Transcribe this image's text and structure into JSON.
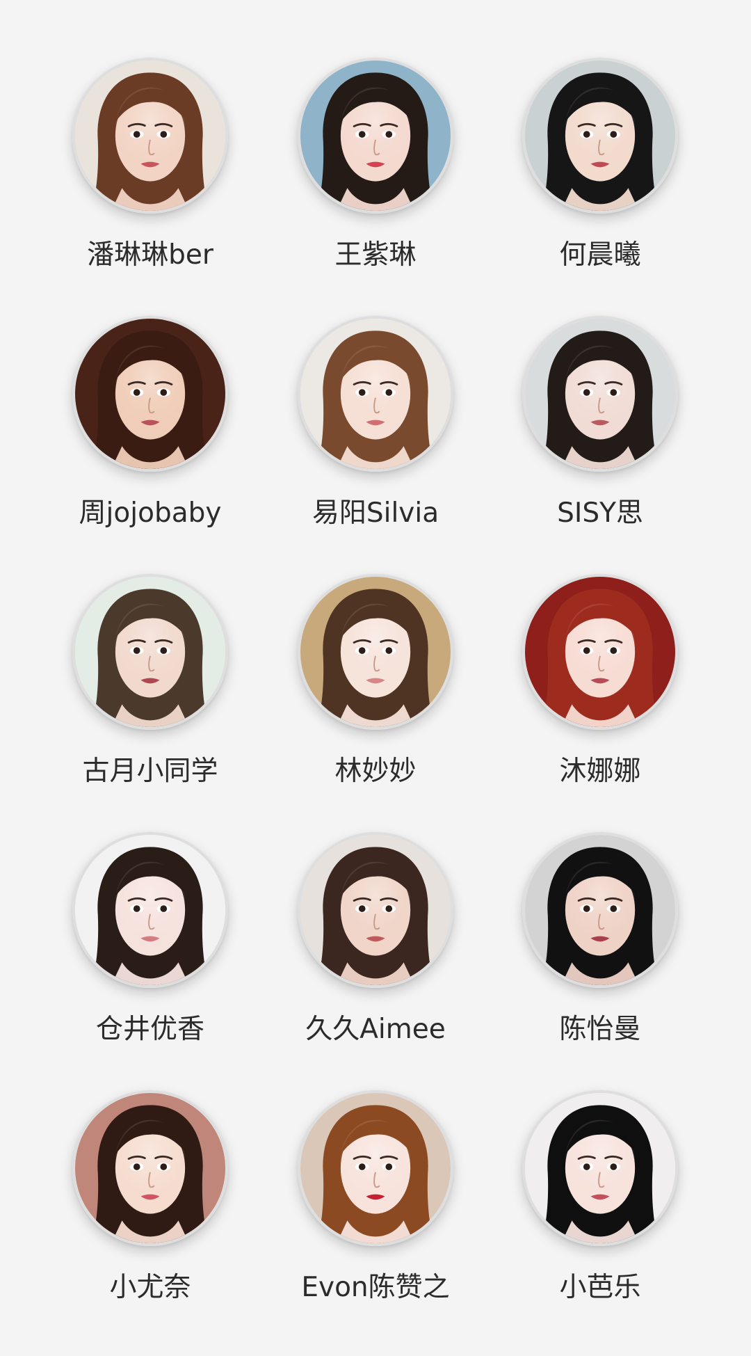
{
  "profiles": [
    {
      "name": "潘琳琳ber",
      "bg": "#e9e3dc",
      "hair": "#6a3c25",
      "skin": "#f2d4c4",
      "lips": "#c9545a"
    },
    {
      "name": "王紫琳",
      "bg": "#8fb3c9",
      "hair": "#241a16",
      "skin": "#f4d9cf",
      "lips": "#d2424f"
    },
    {
      "name": "何晨曦",
      "bg": "#c9d1d3",
      "hair": "#161616",
      "skin": "#f2dacd",
      "lips": "#c04a55"
    },
    {
      "name": "周jojobaby",
      "bg": "#4a2318",
      "hair": "#3a1c12",
      "skin": "#f0cdb8",
      "lips": "#b9525a"
    },
    {
      "name": "易阳Silvia",
      "bg": "#ece8e4",
      "hair": "#7a4a2e",
      "skin": "#f6dfd4",
      "lips": "#cf6f73"
    },
    {
      "name": "SISY思",
      "bg": "#d8dcdd",
      "hair": "#221b18",
      "skin": "#f1dcd5",
      "lips": "#b85a62"
    },
    {
      "name": "古月小同学",
      "bg": "#e4ece6",
      "hair": "#4b3a2c",
      "skin": "#f1d9cd",
      "lips": "#b04650"
    },
    {
      "name": "林妙妙",
      "bg": "#c8a97c",
      "hair": "#4f3424",
      "skin": "#f6e3da",
      "lips": "#d88585"
    },
    {
      "name": "沐娜娜",
      "bg": "#8e1f1a",
      "hair": "#9e2c1e",
      "skin": "#f7dcd4",
      "lips": "#b94a57"
    },
    {
      "name": "仓井优香",
      "bg": "#f2f2f2",
      "hair": "#2a1d18",
      "skin": "#f6e2dd",
      "lips": "#d27b80"
    },
    {
      "name": "久久Aimee",
      "bg": "#e7e1dd",
      "hair": "#3b2720",
      "skin": "#f0d5c8",
      "lips": "#bf5a5f"
    },
    {
      "name": "陈怡曼",
      "bg": "#d3d3d3",
      "hair": "#111111",
      "skin": "#efd2c6",
      "lips": "#a83f4c"
    },
    {
      "name": "小尤奈",
      "bg": "#c0867a",
      "hair": "#2f1a14",
      "skin": "#f6dccf",
      "lips": "#d25463"
    },
    {
      "name": "Evon陈赞之",
      "bg": "#dbc7b8",
      "hair": "#8b4a22",
      "skin": "#f8e3dc",
      "lips": "#c61f31"
    },
    {
      "name": "小芭乐",
      "bg": "#f0eeee",
      "hair": "#0f0f0f",
      "skin": "#f7e2dc",
      "lips": "#c2515d"
    }
  ]
}
